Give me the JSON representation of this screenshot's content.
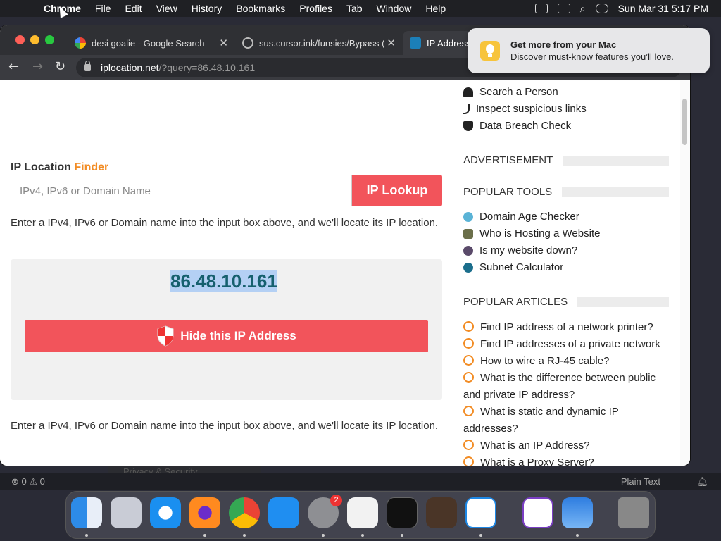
{
  "menubar": {
    "app": "Chrome",
    "items": [
      "File",
      "Edit",
      "View",
      "History",
      "Bookmarks",
      "Profiles",
      "Tab",
      "Window",
      "Help"
    ],
    "clock": "Sun Mar 31  5:17 PM"
  },
  "tabs": [
    {
      "title": "desi goalie - Google Search"
    },
    {
      "title": "sus.cursor.ink/funsies/Bypass (…"
    },
    {
      "title": "IP Address"
    }
  ],
  "address": {
    "host": "iplocation.net",
    "query": "/?query=86.48.10.161"
  },
  "notification": {
    "title": "Get more from your Mac",
    "body": "Discover must-know features you’ll love."
  },
  "main": {
    "title_a": "IP Location",
    "title_b": "Finder",
    "search_placeholder": "IPv4, IPv6 or Domain Name",
    "lookup_label": "IP Lookup",
    "help_text": "Enter a IPv4, IPv6 or Domain name into the input box above, and we'll locate its IP location.",
    "ip": "86.48.10.161",
    "hide_label": "Hide this IP Address",
    "help_text_bottom": "Enter a IPv4, IPv6 or Domain name into the input box above, and we'll locate its IP location."
  },
  "sidebar": {
    "links": [
      "Search a Person",
      "Inspect suspicious links",
      "Data Breach Check"
    ],
    "ad_label": "ADVERTISEMENT",
    "tools_label": "POPULAR TOOLS",
    "tools": [
      "Domain Age Checker",
      "Who is Hosting a Website",
      "Is my website down?",
      "Subnet Calculator"
    ],
    "articles_label": "POPULAR ARTICLES",
    "articles": [
      "Find IP address of a network printer?",
      "Find IP addresses of a private network",
      "How to wire a RJ-45 cable?",
      "What is the difference between public and private IP address?",
      "What is static and dynamic IP addresses?",
      "What is an IP Address?",
      "What is a Proxy Server?"
    ]
  },
  "background": {
    "privacy": "Privacy & Security",
    "problems": "⊗ 0 ⚠ 0",
    "lang": "Plain Text",
    "badge": "2"
  }
}
